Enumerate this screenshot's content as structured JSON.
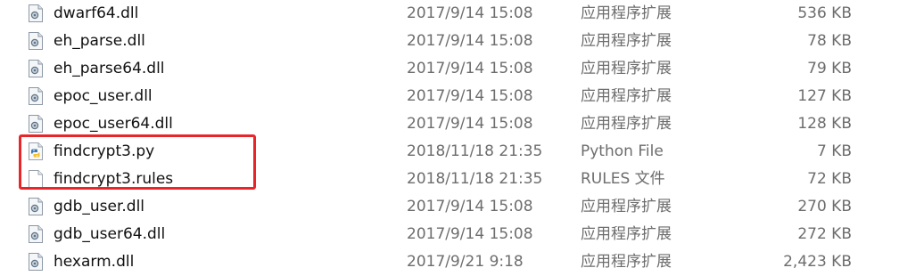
{
  "files": [
    {
      "name": "dwarf64.dll",
      "modified": "2017/9/14 15:08",
      "type": "应用程序扩展",
      "size": "536 KB",
      "icon": "dll-file-icon"
    },
    {
      "name": "eh_parse.dll",
      "modified": "2017/9/14 15:08",
      "type": "应用程序扩展",
      "size": "78 KB",
      "icon": "dll-file-icon"
    },
    {
      "name": "eh_parse64.dll",
      "modified": "2017/9/14 15:08",
      "type": "应用程序扩展",
      "size": "79 KB",
      "icon": "dll-file-icon"
    },
    {
      "name": "epoc_user.dll",
      "modified": "2017/9/14 15:08",
      "type": "应用程序扩展",
      "size": "127 KB",
      "icon": "dll-file-icon"
    },
    {
      "name": "epoc_user64.dll",
      "modified": "2017/9/14 15:08",
      "type": "应用程序扩展",
      "size": "128 KB",
      "icon": "dll-file-icon"
    },
    {
      "name": "findcrypt3.py",
      "modified": "2018/11/18 21:35",
      "type": "Python File",
      "size": "7 KB",
      "icon": "python-file-icon"
    },
    {
      "name": "findcrypt3.rules",
      "modified": "2018/11/18 21:35",
      "type": "RULES 文件",
      "size": "72 KB",
      "icon": "blank-file-icon"
    },
    {
      "name": "gdb_user.dll",
      "modified": "2017/9/14 15:08",
      "type": "应用程序扩展",
      "size": "270 KB",
      "icon": "dll-file-icon"
    },
    {
      "name": "gdb_user64.dll",
      "modified": "2017/9/14 15:08",
      "type": "应用程序扩展",
      "size": "272 KB",
      "icon": "dll-file-icon"
    },
    {
      "name": "hexarm.dll",
      "modified": "2017/9/21 9:18",
      "type": "应用程序扩展",
      "size": "2,423 KB",
      "icon": "dll-file-icon"
    }
  ],
  "colors": {
    "highlight_border": "#e8262a",
    "name_text": "#111111",
    "detail_text": "#6d6d6d"
  }
}
